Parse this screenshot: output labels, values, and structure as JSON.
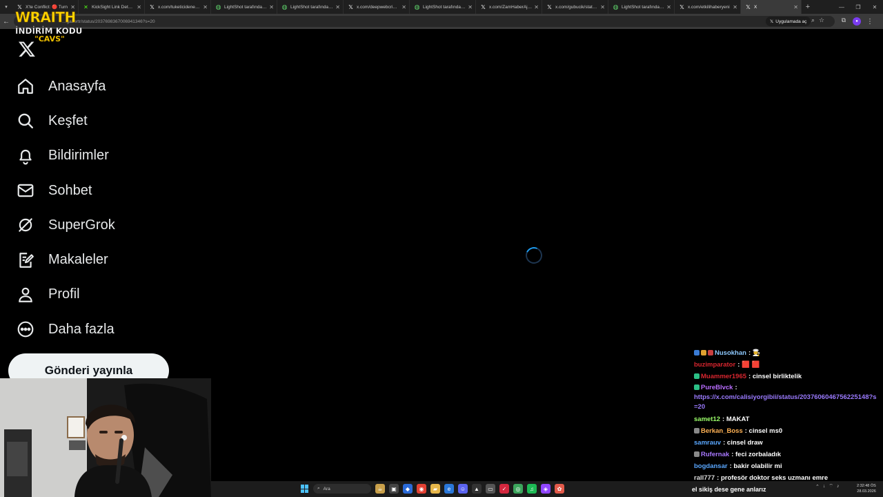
{
  "browser": {
    "tabs": [
      {
        "icon": "x-icon",
        "title": "X'te Conflict: 🔴 Turn"
      },
      {
        "icon": "kicksight-icon",
        "title": "KickSight Link Detector"
      },
      {
        "icon": "x-icon",
        "title": "x.com/tuketicideneyi/s"
      },
      {
        "icon": "lightshot-icon",
        "title": "LightShot tarafından E"
      },
      {
        "icon": "lightshot-icon",
        "title": "LightShot tarafından E"
      },
      {
        "icon": "x-icon",
        "title": "x.com/deepwebcringe"
      },
      {
        "icon": "lightshot-icon",
        "title": "LightShot tarafından E"
      },
      {
        "icon": "x-icon",
        "title": "x.com/ZamHaberAjans"
      },
      {
        "icon": "x-icon",
        "title": "x.com/gubucik/status/"
      },
      {
        "icon": "lightshot-icon",
        "title": "LightShot tarafından E"
      },
      {
        "icon": "x-icon",
        "title": "x.com/etkilihaberyeni"
      }
    ],
    "active_tab": {
      "icon": "x-icon",
      "title": "X"
    },
    "url": "…gabertr/status/2037698367006941346?s=20",
    "open_in_app": "Uygulamada aç"
  },
  "overlay": {
    "brand": "WRAITH",
    "promo_line1": "İNDİRİM KODU",
    "promo_line2": "\"CAVS\""
  },
  "sidebar": {
    "items": [
      {
        "icon": "home-icon",
        "label": "Anasayfa"
      },
      {
        "icon": "search-icon",
        "label": "Keşfet"
      },
      {
        "icon": "bell-icon",
        "label": "Bildirimler"
      },
      {
        "icon": "mail-icon",
        "label": "Sohbet"
      },
      {
        "icon": "grok-icon",
        "label": "SuperGrok"
      },
      {
        "icon": "article-icon",
        "label": "Makaleler"
      },
      {
        "icon": "profile-icon",
        "label": "Profil"
      },
      {
        "icon": "more-icon",
        "label": "Daha fazla"
      }
    ],
    "post_button": "Gönderi yayınla"
  },
  "chat": {
    "messages": [
      {
        "user": "Nusokhan",
        "color": "#8ec9ff",
        "text": "🧑‍🍳",
        "badges": [
          "#3a7bd5",
          "#e0a030",
          "#c94040"
        ]
      },
      {
        "user": "buzimparator",
        "color": "#d9262f",
        "text": "🟥 🟥",
        "badges": []
      },
      {
        "user": "Muammer1965",
        "color": "#d9262f",
        "text": "cinsel birliktelik",
        "badges": [
          "#2bbf85"
        ]
      },
      {
        "user": "PureBlvck",
        "color": "#b96dff",
        "text": "https://x.com/calisiyorgibii/status/2037606046756225148?s=20",
        "badges": [
          "#2bbf85"
        ],
        "is_link": true
      },
      {
        "user": "samet12",
        "color": "#9cff6a",
        "text": "MAKAT",
        "badges": []
      },
      {
        "user": "Berkan_Boss",
        "color": "#ffb255",
        "text": "cinsel ms0",
        "badges": [
          "#888888"
        ]
      },
      {
        "user": "samrauv",
        "color": "#5aa7ff",
        "text": "cinsel draw",
        "badges": []
      },
      {
        "user": "Rufernak",
        "color": "#a878ff",
        "text": "feci zorbaladık",
        "badges": [
          "#888888"
        ]
      },
      {
        "user": "bogdansar",
        "color": "#5aa7ff",
        "text": "bakir olabilir mi",
        "badges": []
      },
      {
        "user": "rall777",
        "color": "#dddddd",
        "text": "profesör doktor seks uzmanı emre",
        "badges": []
      }
    ],
    "ticker": "el sikiş dese gene anlarız"
  },
  "taskbar": {
    "search_placeholder": "Ara",
    "time": "2:32:48 ÖS",
    "date": "28.03.2026"
  }
}
